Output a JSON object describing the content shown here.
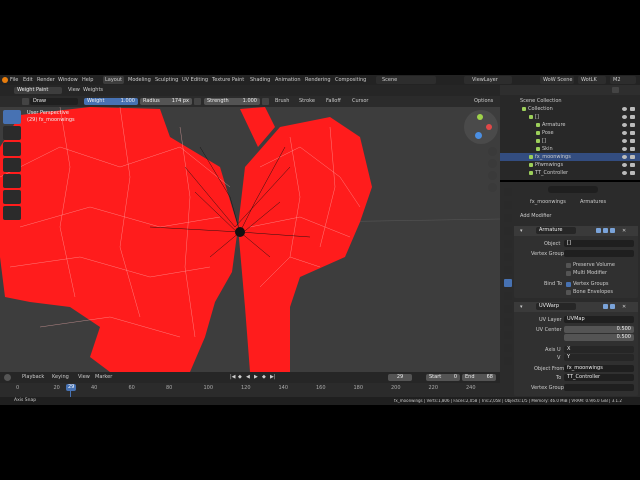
{
  "topbar": {
    "menus": [
      "File",
      "Edit",
      "Render",
      "Window",
      "Help"
    ],
    "workspaces": [
      "Layout",
      "Modeling",
      "Sculpting",
      "UV Editing",
      "Texture Paint",
      "Shading",
      "Animation",
      "Rendering",
      "Compositing"
    ],
    "active_workspace": "Layout",
    "scene_label": "Scene",
    "view_layer": "ViewLayer",
    "right_fields": [
      "WoW Scene",
      "WotLK",
      "M2"
    ]
  },
  "viewport_header": {
    "mode": "Weight Paint",
    "menus": [
      "View",
      "Weights"
    ],
    "brush_name": "Draw",
    "weight_label": "Weight",
    "weight_value": "1.000",
    "radius_label": "Radius",
    "radius_value": "174 px",
    "strength_label": "Strength",
    "strength_value": "1.000",
    "dropdowns": [
      "Brush",
      "Stroke",
      "Falloff",
      "Cursor"
    ],
    "options": "Options"
  },
  "viewport": {
    "view_name": "User Perspective",
    "object_name": "(29) fx_moonwings",
    "accent_color": "#ff1c1c",
    "wire_color": "#ffb3b3"
  },
  "outliner": {
    "root": "Scene Collection",
    "items": [
      {
        "label": "Collection",
        "indent": 0
      },
      {
        "label": "[]",
        "indent": 1
      },
      {
        "label": "Armature",
        "indent": 2
      },
      {
        "label": "Pose",
        "indent": 2
      },
      {
        "label": "[]",
        "indent": 2
      },
      {
        "label": "Skin",
        "indent": 2
      },
      {
        "label": "fx_moonwings",
        "indent": 1,
        "selected": true
      },
      {
        "label": "Pfwmwings",
        "indent": 1
      },
      {
        "label": "TT_Controller",
        "indent": 1
      }
    ]
  },
  "properties": {
    "object_name": "fx_moonwings",
    "breadcrumb_target": "Armatures",
    "add_modifier": "Add Modifier",
    "armature_mod": {
      "name": "Armature",
      "object_label": "Object",
      "object_value": "[]",
      "vgroup_label": "Vertex Group",
      "preserve_volume": "Preserve Volume",
      "multi_modifier": "Multi Modifier",
      "bind_to_label": "Bind To",
      "vertex_groups": "Vertex Groups",
      "bone_envelopes": "Bone Envelopes"
    },
    "uvwarp_mod": {
      "name": "UVWarp",
      "uv_layer_label": "UV Layer",
      "uv_layer_value": "UVMap",
      "uv_center_label": "UV Center",
      "uv_center_x": "0.500",
      "uv_center_y": "0.500",
      "axis_u_label": "Axis U",
      "axis_u_value": "X",
      "axis_v_label": "V",
      "axis_v_value": "Y",
      "object_from_label": "Object From",
      "object_from_value": "fx_moonwings",
      "to_label": "To",
      "to_value": "TT_Controller",
      "vgroup_label": "Vertex Group"
    }
  },
  "timeline": {
    "menus": [
      "Playback",
      "Keying",
      "View",
      "Marker"
    ],
    "current_frame": "29",
    "start_label": "Start",
    "start_value": "0",
    "end_label": "End",
    "end_value": "68",
    "ruler": [
      "0",
      "20",
      "40",
      "60",
      "80",
      "100",
      "120",
      "140",
      "160",
      "180",
      "200",
      "220",
      "240",
      "260"
    ],
    "playhead_label": "29"
  },
  "statusbar": {
    "left": "Axis Snap",
    "center": "fx_moonwings | Verts:1,806 | Faces:2,058 | Tris:2,058 | Objects:1/5 | Memory: 46.0 MiB | VRAM: 0.9/6.0 GiB | 3.1.2"
  }
}
